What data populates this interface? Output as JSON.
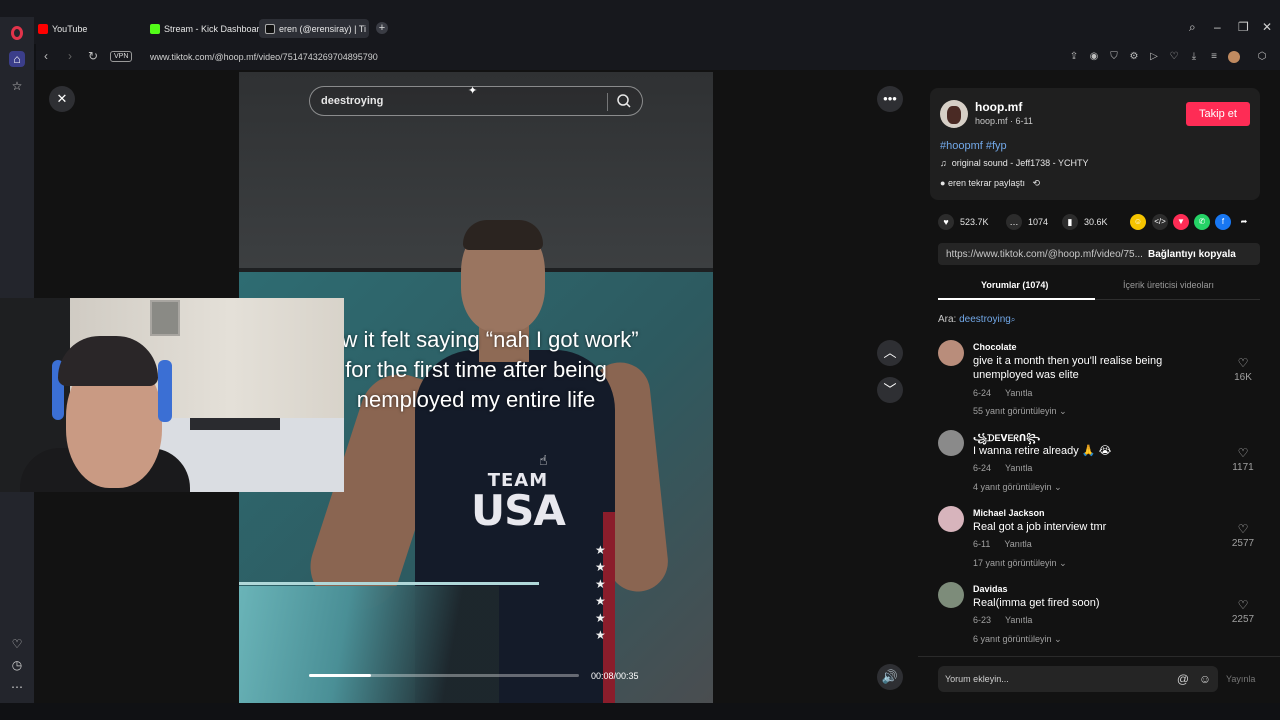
{
  "browser": {
    "tabs": [
      {
        "label": "YouTube"
      },
      {
        "label": "Stream - Kick Dashboard"
      },
      {
        "label": "eren (@erensiray) | Ti"
      }
    ],
    "url": "www.tiktok.com/@hoop.mf/video/7514743269704895790",
    "vpn_label": "VPN"
  },
  "video": {
    "search_value": "deestroying",
    "caption": "How it felt saying “nah I got work” for the first time after being nemployed my entire life",
    "jersey_team": "TEAM",
    "jersey_country": "USA",
    "time": "00:08/00:35",
    "progress": 0.23
  },
  "post": {
    "username": "hoop.mf",
    "subline": "hoop.mf · 6-11",
    "follow_label": "Takip et",
    "hashtags": "#hoopmf #fyp",
    "sound": "original sound - Jeff1738 - YCHTY",
    "repost": "eren tekrar paylaştı",
    "likes": "523.7K",
    "comments_count": "1074",
    "saves": "30.6K",
    "link": "https://www.tiktok.com/@hoop.mf/video/75...",
    "copy_label": "Bağlantıyı kopyala",
    "tab_comments": "Yorumlar (1074)",
    "tab_creator": "İçerik üreticisi videoları",
    "search_prefix": "Ara:",
    "search_term": "deestroying"
  },
  "comments": [
    {
      "name": "Chocolate",
      "text": "give it a month then you'll realise being unemployed was elite",
      "date": "6-24",
      "reply": "Yanıtla",
      "replies": "55 yanıt görüntüleyin",
      "likes": "16K"
    },
    {
      "name": "꧁ᗪEᐯEᖇᑎ꧂",
      "text": "I wanna retire already 🙏 😭",
      "date": "6-24",
      "reply": "Yanıtla",
      "replies": "4 yanıt görüntüleyin",
      "likes": "1171"
    },
    {
      "name": "Michael Jackson",
      "text": "Real got a job interview tmr",
      "date": "6-11",
      "reply": "Yanıtla",
      "replies": "17 yanıt görüntüleyin",
      "likes": "2577"
    },
    {
      "name": "Davidas",
      "text": "Real(imma get fired soon)",
      "date": "6-23",
      "reply": "Yanıtla",
      "replies": "6 yanıt görüntüleyin",
      "likes": "2257"
    }
  ],
  "composer": {
    "placeholder": "Yorum ekleyin...",
    "publish": "Yayınla"
  },
  "colors": {
    "accent": "#fe2c55",
    "link": "#72a8e8"
  }
}
